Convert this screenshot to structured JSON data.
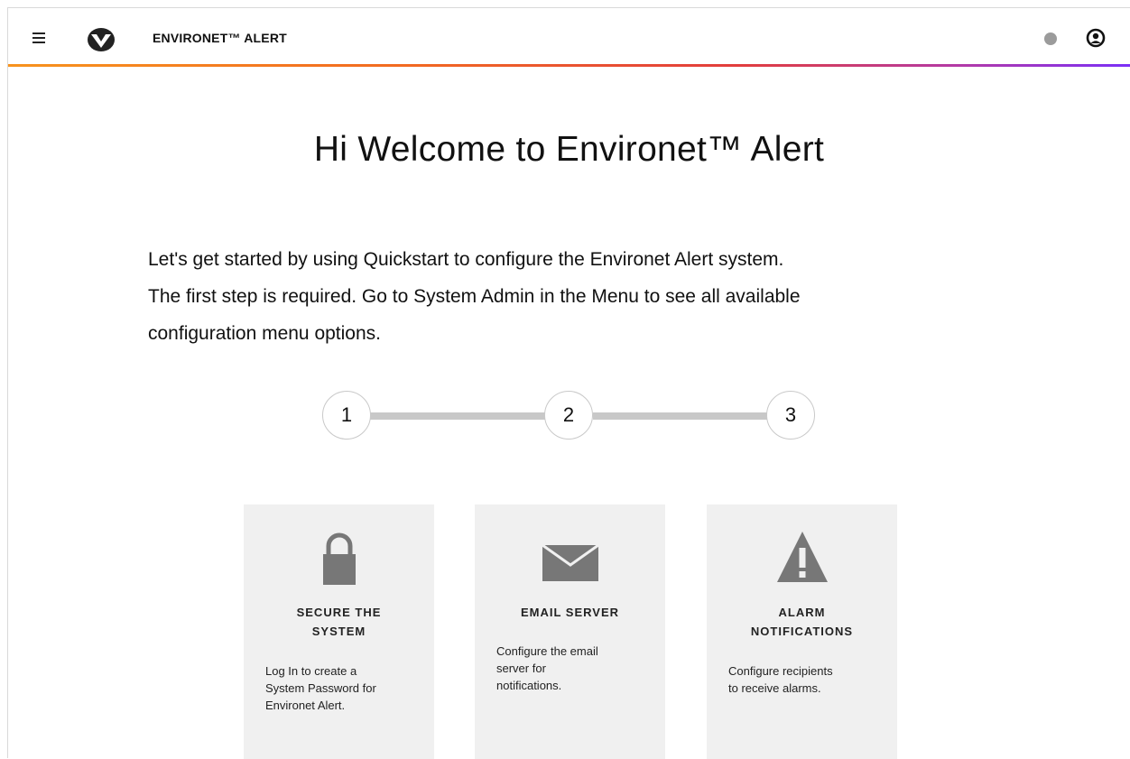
{
  "header": {
    "app_title": "ENVIRONET™ ALERT",
    "accent_gradient": [
      "#f7931e",
      "#f26a21",
      "#e23d3d",
      "#b23aa8",
      "#7b2ff7"
    ],
    "menu_icon": "hamburger-menu-icon",
    "logo_icon": "vertiv-logo-icon",
    "status_indicator_color": "#9b9b9b",
    "user_icon": "user-account-icon"
  },
  "main": {
    "welcome_title": "Hi Welcome to Environet™ Alert",
    "intro_line_1": "Let's get started by using Quickstart to configure the Environet Alert system.",
    "intro_line_2": "The first step is required. Go to System Admin in the Menu to see all available",
    "intro_line_3": "configuration menu options."
  },
  "stepper": {
    "steps": [
      "1",
      "2",
      "3"
    ]
  },
  "cards": [
    {
      "icon": "lock-icon",
      "title_line_1": "SECURE THE",
      "title_line_2": "SYSTEM",
      "desc_line_1": "Log In to create a",
      "desc_line_2": "System Password for",
      "desc_line_3": "Environet Alert."
    },
    {
      "icon": "envelope-icon",
      "title_line_1": "EMAIL SERVER",
      "title_line_2": "",
      "desc_line_1": "Configure the email",
      "desc_line_2": "server for",
      "desc_line_3": "notifications."
    },
    {
      "icon": "warning-icon",
      "title_line_1": "ALARM",
      "title_line_2": "NOTIFICATIONS",
      "desc_line_1": "Configure recipients",
      "desc_line_2": "to receive alarms.",
      "desc_line_3": ""
    }
  ]
}
